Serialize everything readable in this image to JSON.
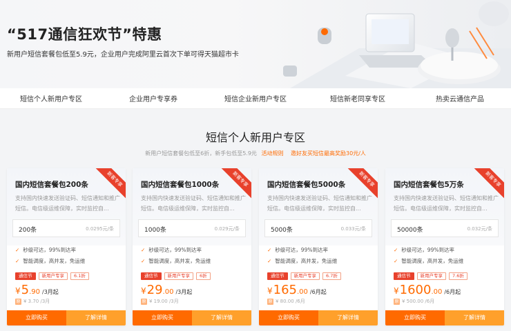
{
  "banner": {
    "title": "“517通信狂欢节”特惠",
    "subtitle": "新用户短信套餐包低至5.9元，企业用户完成阿里云首次下单可得天猫超市卡"
  },
  "nav": [
    "短信个人新用户专区",
    "企业用户专享券",
    "短信企业新用户专区",
    "短信新老同享专区",
    "热卖云通信产品"
  ],
  "section": {
    "title": "短信个人新用户专区",
    "subtitle": "新用户短信套餐包低至6折，新手包低至5.9元",
    "rules_link": "活动规则",
    "invite_link": "邀好友买短信最高奖励30元/人"
  },
  "colors": {
    "accent": "#ff6a00",
    "ribbon": "#e8412c",
    "secondary_button": "#ffa02b"
  },
  "cards": [
    {
      "ribbon": "新客专享",
      "title": "国内短信套餐包200条",
      "desc": "支持国内快速发送验证码、短信通知和推广短信。电信级运维保障，实时监控自...",
      "spec_count": "200条",
      "spec_unit": "0.0295元/条",
      "features": [
        "秒级可达，99%到达率",
        "智能调度，高并发，免运维"
      ],
      "tags": [
        "通信节",
        "新用户专享",
        "6.1折"
      ],
      "price_currency": "¥",
      "price_int": "5",
      "price_dec": ".90",
      "price_per": "/3月起",
      "orig_badge": "原",
      "orig_price": "¥ 3.70 /3月",
      "buy_label": "立即购买",
      "more_label": "了解详情"
    },
    {
      "ribbon": "新客专享",
      "title": "国内短信套餐包1000条",
      "desc": "支持国内快速发送验证码、短信通知和推广短信。电信级运维保障，实时监控自...",
      "spec_count": "1000条",
      "spec_unit": "0.029元/条",
      "features": [
        "秒级可达，99%到达率",
        "智能调度，高并发，免运维"
      ],
      "tags": [
        "通信节",
        "新用户专享",
        "6折"
      ],
      "price_currency": "¥",
      "price_int": "29",
      "price_dec": ".00",
      "price_per": "/3月起",
      "orig_badge": "原",
      "orig_price": "¥ 19.00 /3月",
      "buy_label": "立即购买",
      "more_label": "了解详情"
    },
    {
      "ribbon": "新客专享",
      "title": "国内短信套餐包5000条",
      "desc": "支持国内快速发送验证码、短信通知和推广短信。电信级运维保障，实时监控自...",
      "spec_count": "5000条",
      "spec_unit": "0.033元/条",
      "features": [
        "秒级可达，99%到达率",
        "智能调度，高并发，免运维"
      ],
      "tags": [
        "通信节",
        "新用户专享",
        "6.7折"
      ],
      "price_currency": "¥",
      "price_int": "165",
      "price_dec": ".00",
      "price_per": "/6月起",
      "orig_badge": "原",
      "orig_price": "¥ 80.00 /6月",
      "buy_label": "立即购买",
      "more_label": "了解详情"
    },
    {
      "ribbon": "新客专享",
      "title": "国内短信套餐包5万条",
      "desc": "支持国内快速发送验证码、短信通知和推广短信。电信级运维保障，实时监控自...",
      "spec_count": "50000条",
      "spec_unit": "0.032元/条",
      "features": [
        "秒级可达，99%到达率",
        "智能调度，高并发，免运维"
      ],
      "tags": [
        "通信节",
        "新用户专享",
        "7.6折"
      ],
      "price_currency": "¥",
      "price_int": "1600",
      "price_dec": ".00",
      "price_per": "/6月起",
      "orig_badge": "原",
      "orig_price": "¥ 500.00 /6月",
      "buy_label": "立即购买",
      "more_label": "了解详情"
    }
  ]
}
